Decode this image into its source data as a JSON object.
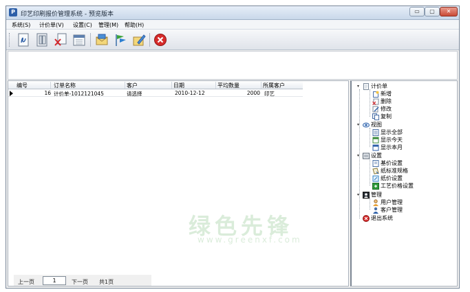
{
  "window": {
    "title": "印艺印刷报价管理系统 - 预览版本",
    "app_icon_letter": "P",
    "min_label": "▭",
    "max_label": "▢",
    "close_label": "✕"
  },
  "menu": [
    {
      "label": "系统(S)"
    },
    {
      "label": "计价单(V)"
    },
    {
      "label": "设置(C)"
    },
    {
      "label": "管理(M)"
    },
    {
      "label": "帮助(H)"
    }
  ],
  "toolbar": {
    "buttons": [
      {
        "icon": "quote-icon"
      },
      {
        "icon": "view-icon"
      },
      {
        "icon": "delete-icon"
      },
      {
        "icon": "calendar-icon"
      },
      {
        "icon": "mail-icon"
      },
      {
        "icon": "flag-icon"
      },
      {
        "icon": "edit-icon"
      },
      {
        "icon": "exit-icon"
      }
    ]
  },
  "grid": {
    "columns": [
      "编号",
      "订单名称",
      "客户",
      "日期",
      "平均数量",
      "所属客户"
    ],
    "rows": [
      {
        "id": "16",
        "order_name": "计价单-1012121045",
        "customer": "请选择",
        "date": "2010-12-12",
        "avg_qty": "2000",
        "owner": "印艺"
      }
    ]
  },
  "pager": {
    "prev_label": "上一页",
    "page_value": "1",
    "next_label": "下一页",
    "total_label": "共1页"
  },
  "tree": {
    "groups": [
      {
        "label": "计价单",
        "icon": "document-icon",
        "toggle": "▾",
        "items": [
          {
            "label": "新增",
            "icon": "new-icon"
          },
          {
            "label": "删除",
            "icon": "delete-icon"
          },
          {
            "label": "修改",
            "icon": "modify-icon"
          },
          {
            "label": "复制",
            "icon": "copy-icon"
          }
        ]
      },
      {
        "label": "视图",
        "icon": "eye-icon",
        "toggle": "▾",
        "items": [
          {
            "label": "显示全部",
            "icon": "list-icon"
          },
          {
            "label": "显示今天",
            "icon": "today-icon"
          },
          {
            "label": "显示本月",
            "icon": "month-icon"
          }
        ]
      },
      {
        "label": "设置",
        "icon": "settings-icon",
        "toggle": "▾",
        "items": [
          {
            "label": "基价设置",
            "icon": "price-icon"
          },
          {
            "label": "纸标准规格",
            "icon": "paper-spec-icon"
          },
          {
            "label": "纸价设置",
            "icon": "paper-price-icon"
          },
          {
            "label": "工艺价格设置",
            "icon": "process-icon"
          }
        ]
      },
      {
        "label": "管理",
        "icon": "admin-icon",
        "toggle": "▾",
        "items": [
          {
            "label": "用户管理",
            "icon": "user-icon"
          },
          {
            "label": "客户管理",
            "icon": "customer-icon"
          }
        ]
      },
      {
        "label": "退出系统",
        "icon": "exit-icon",
        "toggle": "",
        "items": []
      }
    ]
  },
  "watermark": {
    "text": "绿色先锋",
    "sub": "www.greenxf.com"
  },
  "colors": {
    "title_gradient_top": "#e6eef8",
    "title_gradient_bottom": "#c9d8ea",
    "close_red": "#c94a36",
    "exit_red": "#d62b2b"
  }
}
